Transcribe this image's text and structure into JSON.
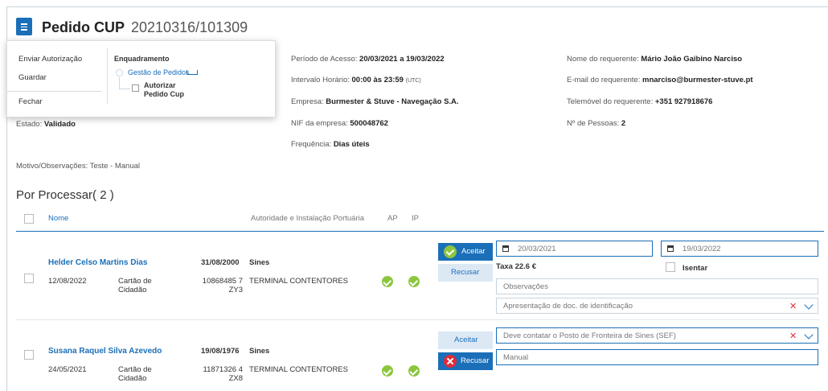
{
  "header": {
    "title": "Pedido CUP",
    "number": "20210316/101309"
  },
  "menu": {
    "items": [
      "Enviar Autorização",
      "Guardar",
      "Fechar"
    ],
    "workflow": {
      "heading": "Enquadramento",
      "step1": "Gestão de Pedidos",
      "step2_line1": "Autorizar",
      "step2_line2": "Pedido Cup"
    }
  },
  "details": {
    "estado_label": "Estado:",
    "estado_value": "Validado",
    "periodo_label": "Período de Acesso:",
    "periodo_value": "20/03/2021 a 19/03/2022",
    "intervalo_label": "Intervalo Horário:",
    "intervalo_value": "00:00 às 23:59",
    "intervalo_tz": "(UTC)",
    "empresa_label": "Empresa:",
    "empresa_value": "Burmester & Stuve - Navegação S.A.",
    "nif_label": "NIF da empresa:",
    "nif_value": "500048762",
    "frequencia_label": "Frequência:",
    "frequencia_value": "Dias úteis",
    "requerente_label": "Nome do requerente:",
    "requerente_value": "Mário João Gaibino Narciso",
    "email_label": "E-mail do requerente:",
    "email_value": "mnarciso@burmester-stuve.pt",
    "tel_label": "Telemóvel do requerente:",
    "tel_value": "+351 927918676",
    "pessoas_label": "Nº de Pessoas:",
    "pessoas_value": "2",
    "motivo": "Motivo/Observações: Teste - Manual"
  },
  "list": {
    "title": "Por Processar( 2 )",
    "col_nome": "Nome",
    "col_autoridade": "Autoridade e Instalação Portuária",
    "col_ap": "AP",
    "col_ip": "IP",
    "rows": [
      {
        "name": "Helder Celso Martins Dias",
        "date": "12/08/2022",
        "doc_line1": "Cartão de",
        "doc_line2": "Cidadão",
        "birth": "31/08/2000",
        "doc_num_line1": "10868485 7",
        "doc_num_line2": "ZY3",
        "port": "Sines",
        "terminal": "TERMINAL CONTENTORES",
        "accept_label": "Aceitar",
        "refuse_label": "Recusar",
        "start_date": "20/03/2021",
        "end_date": "19/03/2022",
        "taxa": "Taxa 22.6 €",
        "isentar": "Isentar",
        "obs_placeholder": "Observações",
        "select_value": "Apresentação de doc. de identificação"
      },
      {
        "name": "Susana Raquel Silva Azevedo",
        "date": "24/05/2021",
        "doc_line1": "Cartão de",
        "doc_line2": "Cidadão",
        "birth": "19/08/1976",
        "doc_num_line1": "11871326 4",
        "doc_num_line2": "ZX8",
        "port": "Sines",
        "terminal": "TERMINAL CONTENTORES",
        "accept_label": "Aceitar",
        "refuse_label": "Recusar",
        "select_value": "Deve contatar o Posto de Fronteira de Sines (SEF)",
        "obs_value": "Manual"
      }
    ]
  },
  "colors": {
    "primary": "#1b6fb8",
    "success": "#8cc63f",
    "danger": "#e02b3a"
  }
}
